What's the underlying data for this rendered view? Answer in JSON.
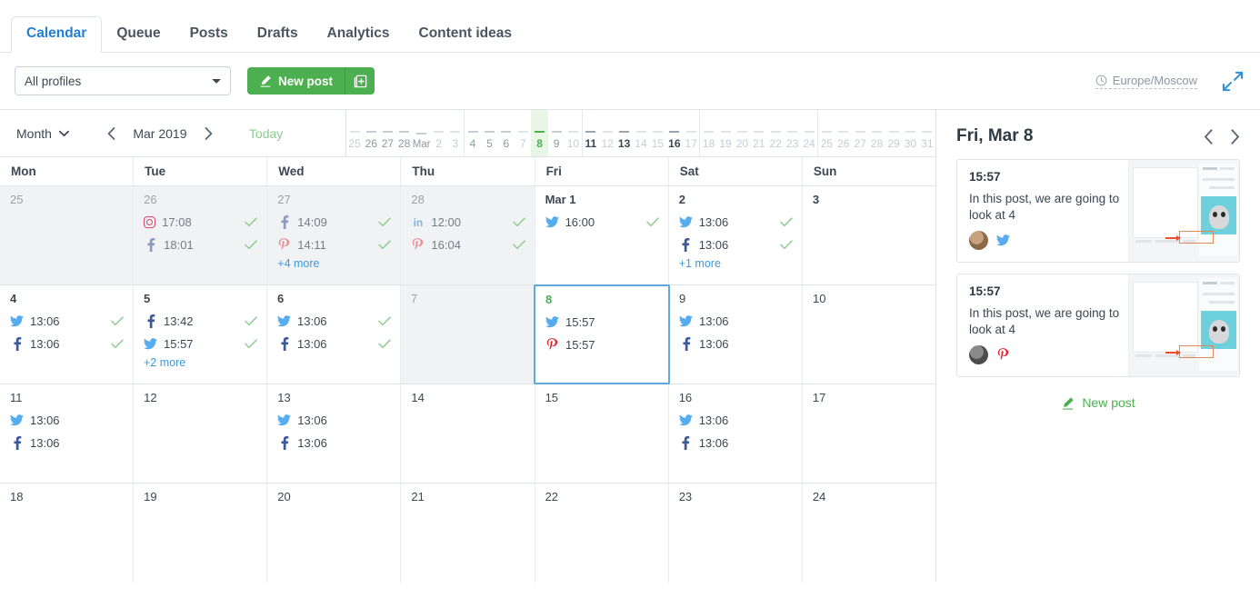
{
  "tabs": [
    {
      "label": "Calendar",
      "active": true
    },
    {
      "label": "Queue",
      "active": false
    },
    {
      "label": "Posts",
      "active": false
    },
    {
      "label": "Drafts",
      "active": false
    },
    {
      "label": "Analytics",
      "active": false
    },
    {
      "label": "Content ideas",
      "active": false
    }
  ],
  "toolbar": {
    "profiles_value": "All profiles",
    "profiles_chevron": "chevron-down-icon",
    "new_post_label": "New post",
    "new_post_extra_icon": "add-to-queue-icon",
    "timezone_label": "Europe/Moscow",
    "timezone_icon": "clock-icon",
    "expand_icon": "expand-arrows-icon",
    "accent_green": "#4cb050",
    "accent_blue": "#1f7fd4"
  },
  "controls": {
    "view_mode": "Month",
    "view_chevron": "chevron-down-icon",
    "prev_icon": "chevron-left-icon",
    "next_icon": "chevron-right-icon",
    "period_label": "Mar 2019",
    "today_label": "Today"
  },
  "timeline": {
    "weeks": [
      [
        {
          "label": "25",
          "weight": "dim"
        },
        {
          "label": "26",
          "weight": "mid"
        },
        {
          "label": "27",
          "weight": "mid"
        },
        {
          "label": "28",
          "weight": "mid"
        },
        {
          "label": "Mar",
          "weight": "mid"
        },
        {
          "label": "2",
          "weight": "dim"
        },
        {
          "label": "3",
          "weight": "dim"
        }
      ],
      [
        {
          "label": "4",
          "weight": "mid"
        },
        {
          "label": "5",
          "weight": "mid"
        },
        {
          "label": "6",
          "weight": "mid"
        },
        {
          "label": "7",
          "weight": "dim"
        },
        {
          "label": "8",
          "weight": "today"
        },
        {
          "label": "9",
          "weight": "mid"
        },
        {
          "label": "10",
          "weight": "dim"
        }
      ],
      [
        {
          "label": "11",
          "weight": "strong"
        },
        {
          "label": "12",
          "weight": "dim"
        },
        {
          "label": "13",
          "weight": "strong"
        },
        {
          "label": "14",
          "weight": "dim"
        },
        {
          "label": "15",
          "weight": "dim"
        },
        {
          "label": "16",
          "weight": "strong"
        },
        {
          "label": "17",
          "weight": "dim"
        }
      ],
      [
        {
          "label": "18",
          "weight": "dim"
        },
        {
          "label": "19",
          "weight": "dim"
        },
        {
          "label": "20",
          "weight": "dim"
        },
        {
          "label": "21",
          "weight": "dim"
        },
        {
          "label": "22",
          "weight": "dim"
        },
        {
          "label": "23",
          "weight": "dim"
        },
        {
          "label": "24",
          "weight": "dim"
        }
      ],
      [
        {
          "label": "25",
          "weight": "dim"
        },
        {
          "label": "26",
          "weight": "dim"
        },
        {
          "label": "27",
          "weight": "dim"
        },
        {
          "label": "28",
          "weight": "dim"
        },
        {
          "label": "29",
          "weight": "dim"
        },
        {
          "label": "30",
          "weight": "dim"
        },
        {
          "label": "31",
          "weight": "dim"
        }
      ]
    ]
  },
  "weekdays": [
    "Mon",
    "Tue",
    "Wed",
    "Thu",
    "Fri",
    "Sat",
    "Sun"
  ],
  "calendar_rows": [
    [
      {
        "day": "25",
        "outside": true,
        "events": [],
        "more": null
      },
      {
        "day": "26",
        "outside": true,
        "more": null,
        "events": [
          {
            "network": "instagram",
            "time": "17:08",
            "sent": true
          },
          {
            "network": "facebook",
            "time": "18:01",
            "sent": true
          }
        ]
      },
      {
        "day": "27",
        "outside": true,
        "more": "+4 more",
        "events": [
          {
            "network": "facebook",
            "time": "14:09",
            "sent": true
          },
          {
            "network": "pinterest",
            "time": "14:11",
            "sent": true
          }
        ]
      },
      {
        "day": "28",
        "outside": true,
        "more": null,
        "events": [
          {
            "network": "linkedin",
            "time": "12:00",
            "sent": true
          },
          {
            "network": "pinterest",
            "time": "16:04",
            "sent": true
          }
        ]
      },
      {
        "day": "Mar 1",
        "outside": false,
        "bold": true,
        "more": null,
        "events": [
          {
            "network": "twitter",
            "time": "16:00",
            "sent": true
          }
        ]
      },
      {
        "day": "2",
        "outside": false,
        "bold": true,
        "more": "+1 more",
        "events": [
          {
            "network": "twitter",
            "time": "13:06",
            "sent": true
          },
          {
            "network": "facebook",
            "time": "13:06",
            "sent": true
          }
        ]
      },
      {
        "day": "3",
        "outside": false,
        "bold": true,
        "events": [],
        "more": null
      }
    ],
    [
      {
        "day": "4",
        "outside": false,
        "bold": true,
        "more": null,
        "events": [
          {
            "network": "twitter",
            "time": "13:06",
            "sent": true
          },
          {
            "network": "facebook",
            "time": "13:06",
            "sent": true
          }
        ]
      },
      {
        "day": "5",
        "outside": false,
        "bold": true,
        "more": "+2 more",
        "events": [
          {
            "network": "facebook",
            "time": "13:42",
            "sent": true
          },
          {
            "network": "twitter",
            "time": "15:57",
            "sent": true
          }
        ]
      },
      {
        "day": "6",
        "outside": false,
        "bold": true,
        "more": null,
        "events": [
          {
            "network": "twitter",
            "time": "13:06",
            "sent": true
          },
          {
            "network": "facebook",
            "time": "13:06",
            "sent": true
          }
        ]
      },
      {
        "day": "7",
        "outside": true,
        "events": [],
        "more": null
      },
      {
        "day": "8",
        "outside": false,
        "today": true,
        "selected": true,
        "more": null,
        "events": [
          {
            "network": "twitter",
            "time": "15:57",
            "sent": false
          },
          {
            "network": "pinterest",
            "time": "15:57",
            "sent": false
          }
        ]
      },
      {
        "day": "9",
        "outside": false,
        "more": null,
        "events": [
          {
            "network": "twitter",
            "time": "13:06",
            "sent": false
          },
          {
            "network": "facebook",
            "time": "13:06",
            "sent": false
          }
        ]
      },
      {
        "day": "10",
        "outside": false,
        "events": [],
        "more": null
      }
    ],
    [
      {
        "day": "11",
        "outside": false,
        "more": null,
        "events": [
          {
            "network": "twitter",
            "time": "13:06",
            "sent": false
          },
          {
            "network": "facebook",
            "time": "13:06",
            "sent": false
          }
        ]
      },
      {
        "day": "12",
        "outside": false,
        "events": [],
        "more": null
      },
      {
        "day": "13",
        "outside": false,
        "more": null,
        "events": [
          {
            "network": "twitter",
            "time": "13:06",
            "sent": false
          },
          {
            "network": "facebook",
            "time": "13:06",
            "sent": false
          }
        ]
      },
      {
        "day": "14",
        "outside": false,
        "events": [],
        "more": null
      },
      {
        "day": "15",
        "outside": false,
        "events": [],
        "more": null
      },
      {
        "day": "16",
        "outside": false,
        "more": null,
        "events": [
          {
            "network": "twitter",
            "time": "13:06",
            "sent": false
          },
          {
            "network": "facebook",
            "time": "13:06",
            "sent": false
          }
        ]
      },
      {
        "day": "17",
        "outside": false,
        "events": [],
        "more": null
      }
    ],
    [
      {
        "day": "18",
        "outside": false,
        "events": [],
        "more": null
      },
      {
        "day": "19",
        "outside": false,
        "events": [],
        "more": null
      },
      {
        "day": "20",
        "outside": false,
        "events": [],
        "more": null
      },
      {
        "day": "21",
        "outside": false,
        "events": [],
        "more": null
      },
      {
        "day": "22",
        "outside": false,
        "events": [],
        "more": null
      },
      {
        "day": "23",
        "outside": false,
        "events": [],
        "more": null
      },
      {
        "day": "24",
        "outside": false,
        "events": [],
        "more": null
      }
    ]
  ],
  "sidebar": {
    "title": "Fri, Mar 8",
    "prev_icon": "chevron-left-icon",
    "next_icon": "chevron-right-icon",
    "new_post_label": "New post",
    "new_post_icon": "pencil-icon",
    "posts": [
      {
        "time": "15:57",
        "text": "In this post, we are going to look at 4",
        "network": "twitter",
        "avatar": "dog-avatar"
      },
      {
        "time": "15:57",
        "text": "In this post, we are going to look at 4",
        "network": "pinterest",
        "avatar": "grey-avatar"
      }
    ]
  },
  "icon_glyphs": {
    "twitter": "twitter-icon",
    "facebook": "facebook-icon",
    "pinterest": "pinterest-icon",
    "linkedin": "linkedin-icon",
    "instagram": "instagram-icon",
    "check": "check-icon"
  }
}
